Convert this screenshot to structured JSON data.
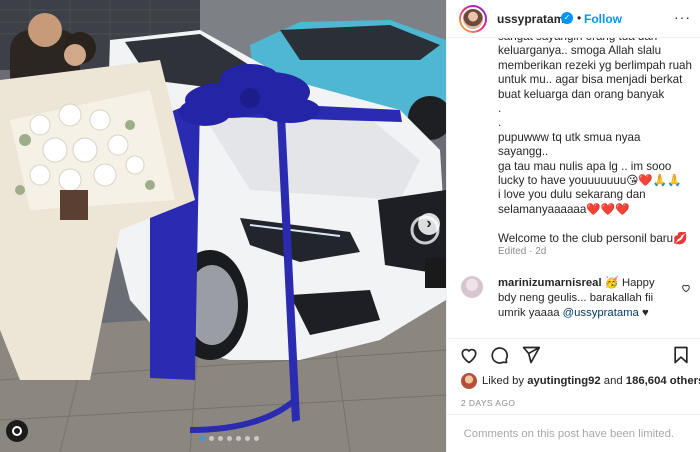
{
  "post": {
    "username": "ussypratama",
    "verified_glyph": "✓",
    "separator": "•",
    "follow_label": "Follow",
    "more_glyph": "···",
    "caption_lines": [
      "sangat sayangin orang tua dan",
      "keluarganya.. smoga Allah slalu",
      "memberikan rezeki yg berlimpah ruah",
      "untuk mu.. agar bisa menjadi berkat",
      "buat keluarga dan orang banyak",
      ".",
      ".",
      "pupuwww tq utk smua nyaa sayangg..",
      "ga tau mau nulis apa lg .. im sooo",
      "lucky to have youuuuuuu😘❤️🙏🙏",
      "i love you dulu sekarang dan",
      "selamanyaaaaaa❤️❤️❤️",
      "",
      "Welcome to the club personil baru💋"
    ],
    "edited": "Edited · 2d",
    "comment": {
      "user": "marinizumarnisreal",
      "text": " 🥳 Happy bdy neng geulis... barakallah fii umrik yaaaa ",
      "mention": "@ussypratama",
      "tail": " ♥"
    },
    "likes": {
      "prefix": "Liked by ",
      "user": "ayutingting92",
      "mid": " and ",
      "count": "186,604 others"
    },
    "date": "2 DAYS AGO",
    "comments_limited": "Comments on this post have been limited.",
    "next_glyph": "›",
    "carousel": {
      "total": 7,
      "active_index": 0
    }
  },
  "colors": {
    "accent": "#0095f6",
    "ribbon": "#2a2bb0",
    "car": "#f2f3f5",
    "turquoise": "#4fb7d1",
    "muted": "#8e8e8e"
  },
  "icons": [
    "heart-icon",
    "comment-icon",
    "share-icon",
    "bookmark-icon",
    "verified-icon",
    "more-icon",
    "chevron-right-icon",
    "instagram-icon"
  ]
}
